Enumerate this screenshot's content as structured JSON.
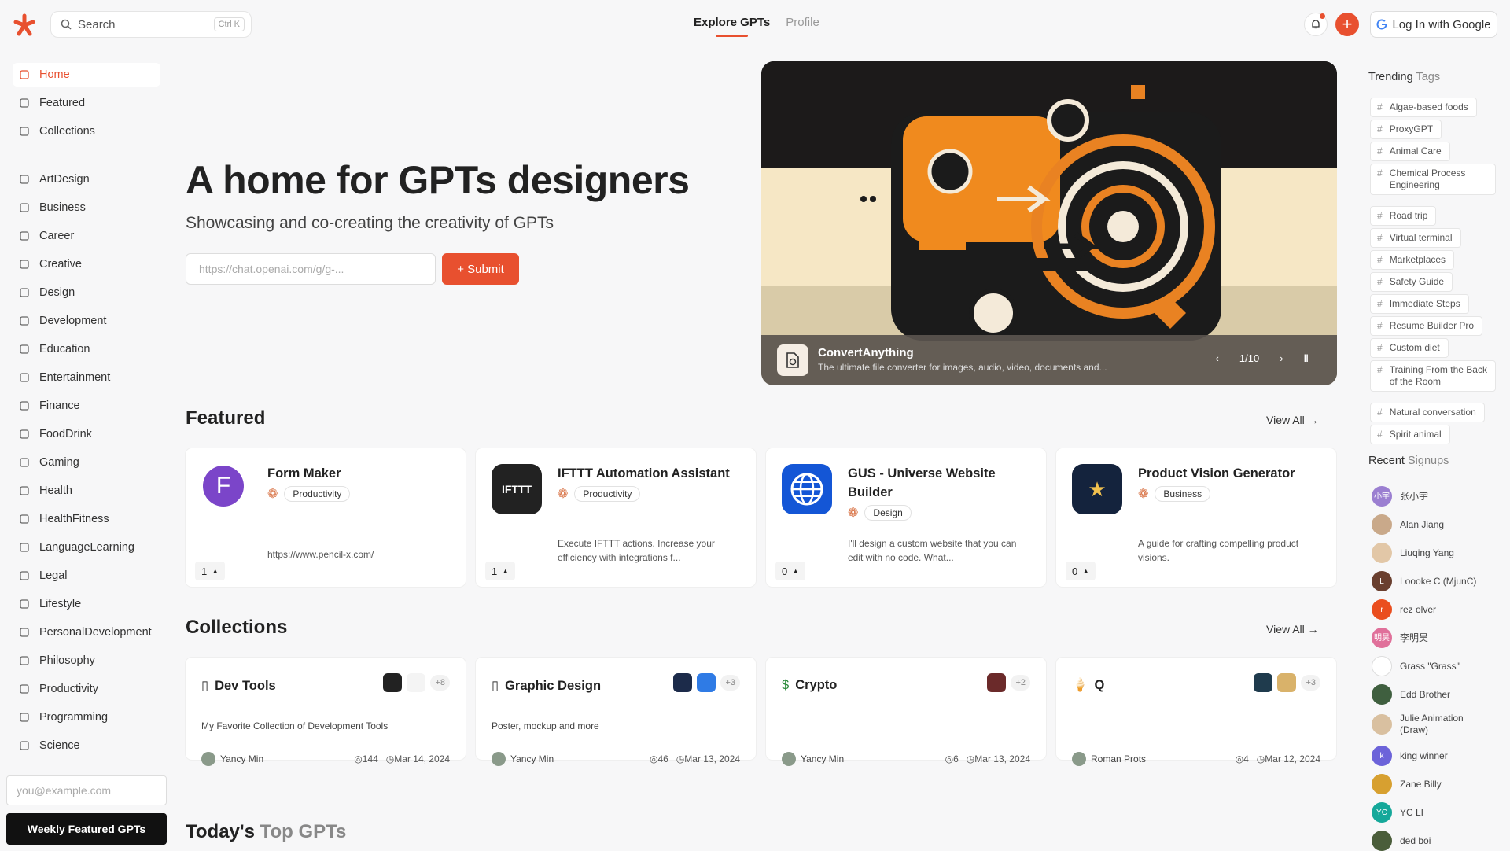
{
  "topbar": {
    "search_placeholder": "Search",
    "search_shortcut": "Ctrl K",
    "tabs": [
      {
        "label": "Explore GPTs",
        "active": true
      },
      {
        "label": "Profile",
        "active": false
      }
    ],
    "login_label": "Log In with Google",
    "plus_label": "+",
    "accent": "#e8502f"
  },
  "sidebar": {
    "items": [
      {
        "label": "Home",
        "icon": "home-icon"
      },
      {
        "label": "Featured",
        "icon": "award-icon"
      },
      {
        "label": "Collections",
        "icon": "folder-icon"
      },
      {
        "label": "ArtDesign",
        "icon": "brush-icon"
      },
      {
        "label": "Business",
        "icon": "briefcase-icon"
      },
      {
        "label": "Career",
        "icon": "user-icon"
      },
      {
        "label": "Creative",
        "icon": "pen-icon"
      },
      {
        "label": "Design",
        "icon": "palette-icon"
      },
      {
        "label": "Development",
        "icon": "code-icon"
      },
      {
        "label": "Education",
        "icon": "book-icon"
      },
      {
        "label": "Entertainment",
        "icon": "film-icon"
      },
      {
        "label": "Finance",
        "icon": "dollar-icon"
      },
      {
        "label": "FoodDrink",
        "icon": "cup-icon"
      },
      {
        "label": "Gaming",
        "icon": "gamepad-icon"
      },
      {
        "label": "Health",
        "icon": "heart-icon"
      },
      {
        "label": "HealthFitness",
        "icon": "dumbbell-icon"
      },
      {
        "label": "LanguageLearning",
        "icon": "language-icon"
      },
      {
        "label": "Legal",
        "icon": "scale-icon"
      },
      {
        "label": "Lifestyle",
        "icon": "person-icon"
      },
      {
        "label": "PersonalDevelopment",
        "icon": "user-plus-icon"
      },
      {
        "label": "Philosophy",
        "icon": "notebook-icon"
      },
      {
        "label": "Productivity",
        "icon": "clock-icon"
      },
      {
        "label": "Programming",
        "icon": "laptop-icon"
      },
      {
        "label": "Science",
        "icon": "wifi-icon"
      }
    ],
    "email_placeholder": "you@example.com",
    "weekly_label": "Weekly Featured GPTs"
  },
  "hero": {
    "title": "A home for GPTs designers",
    "subtitle": "Showcasing and co-creating the creativity of GPTs",
    "url_placeholder": "https://chat.openai.com/g/g-...",
    "submit_label": "+ Submit"
  },
  "banner": {
    "title": "ConvertAnything",
    "description": "The ultimate file converter for images, audio, video, documents and...",
    "page": "1/10"
  },
  "featured": {
    "title": "Featured",
    "view_all": "View All",
    "cards": [
      {
        "name": "Form Maker",
        "tag": "Productivity",
        "desc": "https://www.pencil-x.com/",
        "votes": "1"
      },
      {
        "name": "IFTTT Automation Assistant",
        "tag": "Productivity",
        "desc": "Execute IFTTT actions. Increase your efficiency with integrations f...",
        "votes": "1"
      },
      {
        "name": "GUS - Universe Website Builder",
        "tag": "Design",
        "desc": "I'll design a custom website that you can edit with no code. What...",
        "votes": "0"
      },
      {
        "name": "Product Vision Generator",
        "tag": "Business",
        "desc": "A guide for crafting compelling product visions.",
        "votes": "0"
      }
    ],
    "avatar_letter": "F",
    "ifttt_text": "IFTTT"
  },
  "collections": {
    "title": "Collections",
    "view_all": "View All",
    "cards": [
      {
        "name": "Dev Tools",
        "desc": "My Favorite Collection of Development Tools",
        "author": "Yancy Min",
        "views": "144",
        "date": "Mar 14, 2024",
        "more": "+8",
        "emoji": "▯"
      },
      {
        "name": "Graphic Design",
        "desc": "Poster, mockup and more",
        "author": "Yancy Min",
        "views": "46",
        "date": "Mar 13, 2024",
        "more": "+3",
        "emoji": "▯"
      },
      {
        "name": "Crypto",
        "desc": "",
        "author": "Yancy Min",
        "views": "6",
        "date": "Mar 13, 2024",
        "more": "+2",
        "emoji": "$"
      },
      {
        "name": "Q",
        "desc": "",
        "author": "Roman Prots",
        "views": "4",
        "date": "Mar 12, 2024",
        "more": "+3",
        "emoji": "🍦"
      }
    ]
  },
  "today": {
    "part1": "Today's",
    "part2": "Top GPTs"
  },
  "trending": {
    "title_main": "Trending",
    "title_dim": "Tags",
    "tags": [
      "Algae-based foods",
      "ProxyGPT",
      "Animal Care",
      "Chemical Process Engineering",
      "Road trip",
      "Virtual terminal",
      "Marketplaces",
      "Safety Guide",
      "Immediate Steps",
      "Resume Builder Pro",
      "Custom diet",
      "Training From the Back of the Room",
      "Natural conversation",
      "Spirit animal"
    ]
  },
  "signups": {
    "title_main": "Recent",
    "title_dim": "Signups",
    "users": [
      {
        "name": "张小宇",
        "initials": "小宇",
        "color": "#9b7fd1"
      },
      {
        "name": "Alan Jiang",
        "initials": "",
        "color": "#c9a98a"
      },
      {
        "name": "Liuqing Yang",
        "initials": "",
        "color": "#e2c7a7"
      },
      {
        "name": "Loooke C (MjunC)",
        "initials": "L",
        "color": "#6a3f2f"
      },
      {
        "name": "rez olver",
        "initials": "r",
        "color": "#ea4e1e"
      },
      {
        "name": "李明昊",
        "initials": "明昊",
        "color": "#e0709a"
      },
      {
        "name": "Grass \"Grass\"",
        "initials": "",
        "color": "#ffffff"
      },
      {
        "name": "Edd Brother",
        "initials": "",
        "color": "#3f5f3f"
      },
      {
        "name": "Julie Animation (Draw)",
        "initials": "",
        "color": "#d9c0a0"
      },
      {
        "name": "king winner",
        "initials": "k",
        "color": "#6c63d9"
      },
      {
        "name": "Zane Billy",
        "initials": "",
        "color": "#d7a030"
      },
      {
        "name": "YC LI",
        "initials": "YC",
        "color": "#15a89a"
      },
      {
        "name": "ded boi",
        "initials": "",
        "color": "#4a5d3a"
      }
    ]
  }
}
